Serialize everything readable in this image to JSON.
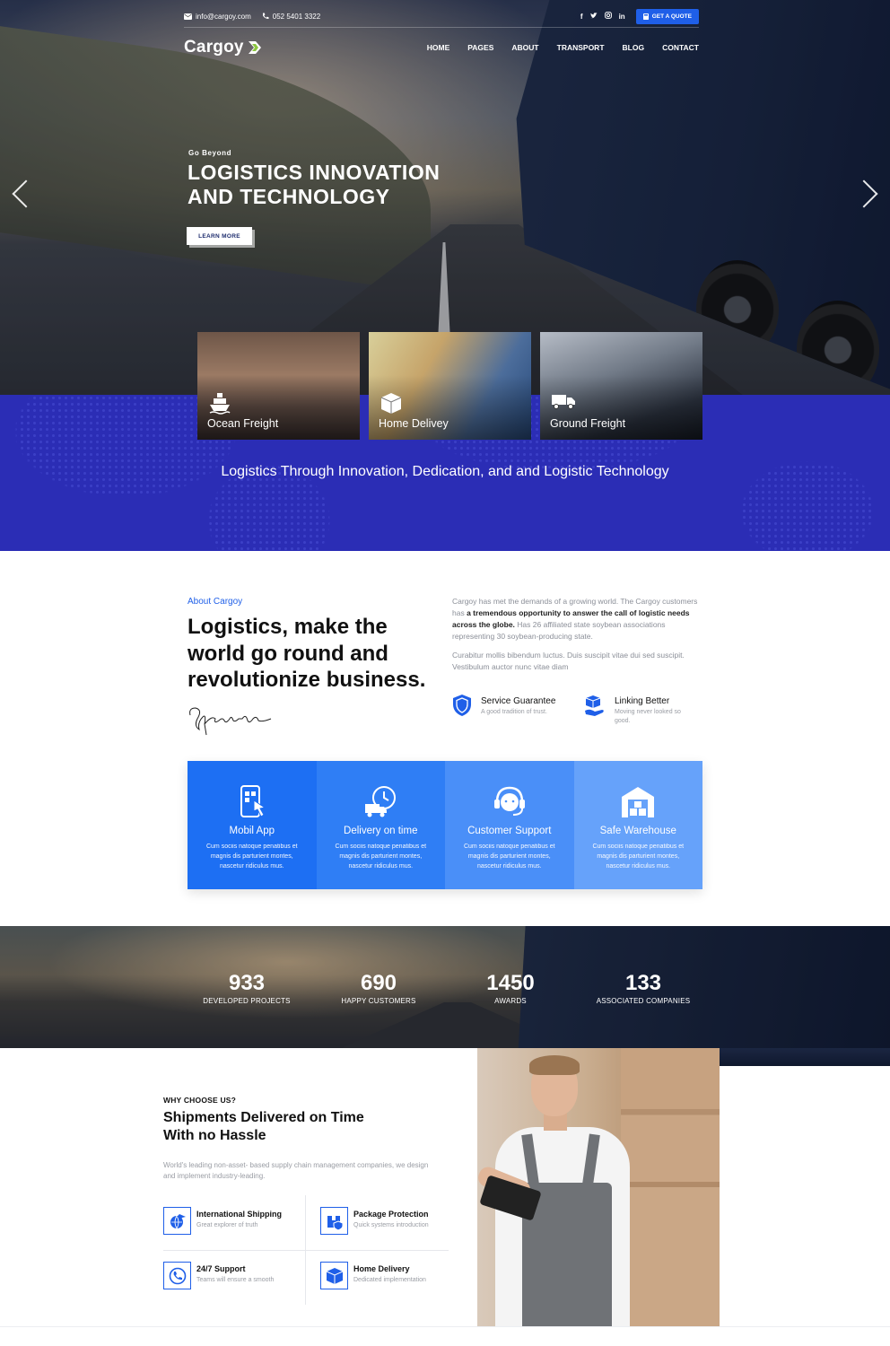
{
  "topbar": {
    "email": "info@cargoy.com",
    "phone": "052 5401 3322",
    "quote_label": "GET A QUOTE"
  },
  "brand": {
    "name": "Cargoy",
    "accent": "#8cc63f"
  },
  "nav": {
    "items": [
      "HOME",
      "PAGES",
      "ABOUT",
      "TRANSPORT",
      "BLOG",
      "CONTACT"
    ]
  },
  "hero": {
    "subtitle": "Go Beyond",
    "title": "LOGISTICS INNOVATION AND TECHNOLOGY",
    "button": "LEARN MORE"
  },
  "services": [
    {
      "label": "Ocean Freight",
      "icon": "ship-icon"
    },
    {
      "label": "Home Delivey",
      "icon": "box-icon"
    },
    {
      "label": "Ground Freight",
      "icon": "truck-icon"
    }
  ],
  "band": {
    "text": "Logistics Through Innovation, Dedication, and and Logistic Technology",
    "color": "#2b2db5"
  },
  "about": {
    "label": "About Cargoy",
    "title": "Logistics, make the world go round and revolutionize business.",
    "p1_start": "Cargoy has met the demands of a growing world. The Cargoy customers has",
    "p1_bold": "a tremendous opportunity to answer the call of logistic needs across the globe.",
    "p1_end": "Has 26 affiliated state soybean associations representing 30 soybean-producing state.",
    "p2": "Curabitur mollis bibendum luctus. Duis suscipit vitae dui sed suscipit. Vestibulum auctor nunc vitae diam",
    "features": [
      {
        "title": "Service Guarantee",
        "desc": "A good tradition of trust.",
        "icon": "shield-icon"
      },
      {
        "title": "Linking Better",
        "desc": "Moving never looked so good.",
        "icon": "hand-box-icon"
      }
    ]
  },
  "tiles": [
    {
      "title": "Mobil App",
      "desc": "Cum sociis natoque penatibus et magnis dis parturient montes, nascetur ridiculus mus.",
      "icon": "mobile-app-icon"
    },
    {
      "title": "Delivery on time",
      "desc": "Cum sociis natoque penatibus et magnis dis parturient montes, nascetur ridiculus mus.",
      "icon": "delivery-clock-icon"
    },
    {
      "title": "Customer Support",
      "desc": "Cum sociis natoque penatibus et magnis dis parturient montes, nascetur ridiculus mus.",
      "icon": "headset-icon"
    },
    {
      "title": "Safe Warehouse",
      "desc": "Cum sociis natoque penatibus et magnis dis parturient montes, nascetur ridiculus mus.",
      "icon": "warehouse-icon"
    }
  ],
  "stats": [
    {
      "value": "933",
      "label": "DEVELOPED PROJECTS"
    },
    {
      "value": "690",
      "label": "HAPPY CUSTOMERS"
    },
    {
      "value": "1450",
      "label": "AWARDS"
    },
    {
      "value": "133",
      "label": "ASSOCIATED COMPANIES"
    }
  ],
  "why": {
    "label": "WHY CHOOSE US?",
    "title": "Shipments Delivered on Time With no Hassle",
    "text": "World's leading non-asset- based supply chain management companies, we design and implement industry-leading.",
    "features": [
      {
        "title": "International Shipping",
        "desc": "Great explorer of truth",
        "icon": "globe-plane-icon"
      },
      {
        "title": "Package Protection",
        "desc": "Quick systems introduction",
        "icon": "package-shield-icon"
      },
      {
        "title": "24/7 Support",
        "desc": "Teams will ensure a smooth",
        "icon": "phone-support-icon"
      },
      {
        "title": "Home Delivery",
        "desc": "Dedicated implementation",
        "icon": "cube-icon"
      }
    ]
  }
}
